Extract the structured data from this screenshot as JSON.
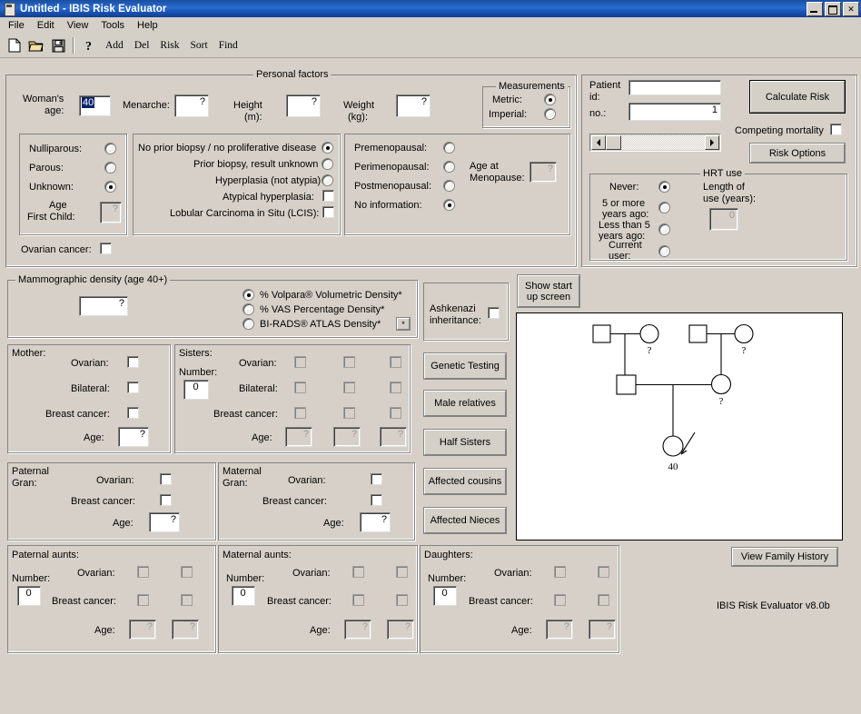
{
  "window": {
    "title": "Untitled - IBIS Risk Evaluator",
    "icon": "app-icon",
    "minimize": "minimize-button",
    "maximize": "maximize-button",
    "close": "✕"
  },
  "menu": [
    "File",
    "Edit",
    "View",
    "Tools",
    "Help"
  ],
  "toolbar": {
    "icons": [
      "new-document-icon",
      "open-folder-icon",
      "save-disk-icon",
      "help-question-icon"
    ],
    "text_buttons": [
      "Add",
      "Del",
      "Risk",
      "Sort",
      "Find"
    ]
  },
  "personal_factors": {
    "title": "Personal factors",
    "womans_age_label": "Woman's\nage:",
    "womans_age_label_l1": "Woman's",
    "womans_age_label_l2": "age:",
    "womans_age_value": "40",
    "menarche_label": "Menarche:",
    "menarche_value": "?",
    "height_label_l1": "Height",
    "height_label_l2": "(m):",
    "height_value": "?",
    "weight_label_l1": "Weight",
    "weight_label_l2": "(kg):",
    "weight_value": "?",
    "measurements": {
      "title": "Measurements",
      "options": [
        {
          "label": "Metric:",
          "selected": true
        },
        {
          "label": "Imperial:",
          "selected": false
        }
      ]
    },
    "parity": {
      "options": [
        {
          "label": "Nulliparous:",
          "selected": false
        },
        {
          "label": "Parous:",
          "selected": false
        },
        {
          "label": "Unknown:",
          "selected": true
        }
      ],
      "age_first_child_l1": "Age",
      "age_first_child_l2": "First Child:",
      "age_first_child_value": "?"
    },
    "biopsy": {
      "options": [
        {
          "label": "No prior biopsy / no proliferative disease",
          "selected": true
        },
        {
          "label": "Prior biopsy, result unknown",
          "selected": false
        },
        {
          "label": "Hyperplasia (not atypia)",
          "selected": false
        }
      ],
      "checkboxes": [
        {
          "label": "Atypical hyperplasia:",
          "checked": false
        },
        {
          "label": "Lobular Carcinoma in Situ (LCIS):",
          "checked": false
        }
      ]
    },
    "menopause": {
      "options": [
        {
          "label": "Premenopausal:",
          "selected": false
        },
        {
          "label": "Perimenopausal:",
          "selected": false
        },
        {
          "label": "Postmenopausal:",
          "selected": false
        },
        {
          "label": "No information:",
          "selected": true
        }
      ],
      "age_at_menopause_l1": "Age at",
      "age_at_menopause_l2": "Menopause:",
      "age_at_menopause_value": "?"
    },
    "ovarian_cancer_label": "Ovarian cancer:",
    "ovarian_cancer_checked": false
  },
  "patient": {
    "id_label_l1": "Patient",
    "id_label_l2": "id:",
    "id_value": "",
    "no_label": "no.:",
    "no_value": "1",
    "calculate_risk": "Calculate Risk",
    "competing_mortality_label": "Competing mortality",
    "competing_mortality_checked": false,
    "risk_options": "Risk Options"
  },
  "hrt": {
    "title": "HRT use",
    "options": [
      {
        "label_l1": "Never:",
        "label_l2": "",
        "selected": true
      },
      {
        "label_l1": "5 or more",
        "label_l2": "years ago:",
        "selected": false
      },
      {
        "label_l1": "Less than 5",
        "label_l2": "years ago:",
        "selected": false
      },
      {
        "label_l1": "Current",
        "label_l2": "user:",
        "selected": false
      }
    ],
    "length_label_l1": "Length of",
    "length_label_l2": "use (years):",
    "length_value": "0"
  },
  "mammographic": {
    "title": "Mammographic density (age 40+)",
    "value": "?",
    "options": [
      {
        "label": "% Volpara® Volumetric Density*",
        "selected": true
      },
      {
        "label": "% VAS Percentage Density*",
        "selected": false
      },
      {
        "label": "BI-RADS® ATLAS Density*",
        "selected": false
      }
    ],
    "asterisk_button": "*"
  },
  "ashkenazi": {
    "label_l1": "Ashkenazi",
    "label_l2": "inheritance:",
    "checked": false
  },
  "show_start_up": {
    "line1": "Show start",
    "line2": "up screen"
  },
  "side_buttons": [
    "Genetic Testing",
    "Male relatives",
    "Half Sisters",
    "Affected cousins",
    "Affected Nieces"
  ],
  "mother": {
    "title": "Mother:",
    "rows": [
      {
        "label": "Ovarian:",
        "checked": false
      },
      {
        "label": "Bilateral:",
        "checked": false
      },
      {
        "label": "Breast cancer:",
        "checked": false
      }
    ],
    "age_label": "Age:",
    "age_value": "?"
  },
  "sisters": {
    "title": "Sisters:",
    "number_label": "Number:",
    "number_value": "0",
    "rows": [
      "Ovarian:",
      "Bilateral:",
      "Breast cancer:"
    ],
    "age_label": "Age:",
    "age_values": [
      "?",
      "?",
      "?"
    ],
    "columns": 3
  },
  "paternal_gran": {
    "title_l1": "Paternal",
    "title_l2": "Gran:",
    "rows": [
      {
        "label": "Ovarian:",
        "checked": false
      },
      {
        "label": "Breast cancer:",
        "checked": false
      }
    ],
    "age_label": "Age:",
    "age_value": "?"
  },
  "maternal_gran": {
    "title_l1": "Maternal",
    "title_l2": "Gran:",
    "rows": [
      {
        "label": "Ovarian:",
        "checked": false
      },
      {
        "label": "Breast cancer:",
        "checked": false
      }
    ],
    "age_label": "Age:",
    "age_value": "?"
  },
  "paternal_aunts": {
    "title": "Paternal aunts:",
    "number_label": "Number:",
    "number_value": "0",
    "rows": [
      "Ovarian:",
      "Breast cancer:"
    ],
    "age_label": "Age:",
    "age_values": [
      "?",
      "?"
    ]
  },
  "maternal_aunts": {
    "title": "Maternal aunts:",
    "number_label": "Number:",
    "number_value": "0",
    "rows": [
      "Ovarian:",
      "Breast cancer:"
    ],
    "age_label": "Age:",
    "age_values": [
      "?",
      "?"
    ]
  },
  "daughters": {
    "title": "Daughters:",
    "number_label": "Number:",
    "number_value": "0",
    "rows": [
      "Ovarian:",
      "Breast cancer:"
    ],
    "age_label": "Age:",
    "age_values": [
      "?",
      "?"
    ]
  },
  "pedigree": {
    "labels": {
      "paternal_grandmother": "?",
      "maternal_grandmother": "?",
      "mother": "?",
      "proband_age": "40"
    }
  },
  "view_family_history": "View Family History",
  "version_text": "IBIS Risk Evaluator v8.0b",
  "colors": {
    "face": "#d6d0c8",
    "titlebar": "#1d5bc0",
    "field": "#ffffff",
    "shadow": "#808080"
  }
}
